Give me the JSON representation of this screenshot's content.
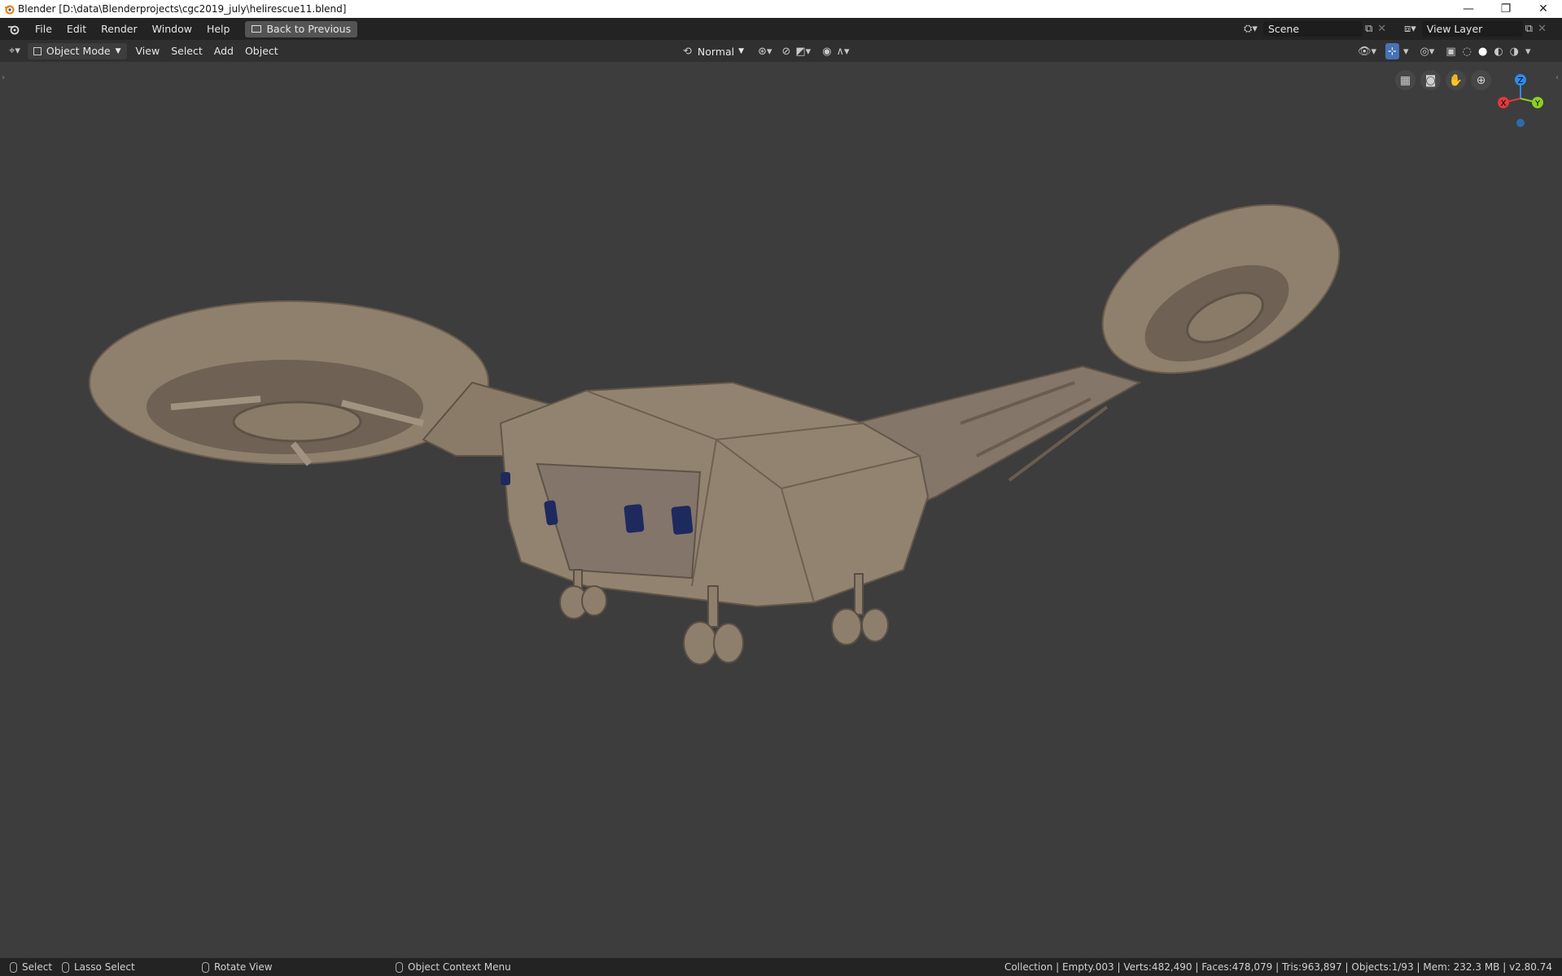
{
  "window": {
    "title": "Blender [D:\\data\\Blenderprojects\\cgc2019_july\\helirescue11.blend]",
    "minimize": "—",
    "restore": "❐",
    "close": "✕"
  },
  "menu": {
    "items": [
      "File",
      "Edit",
      "Render",
      "Window",
      "Help"
    ],
    "back_button": "Back to Previous"
  },
  "scene": {
    "value": "Scene"
  },
  "view_layer": {
    "value": "View Layer"
  },
  "header": {
    "mode": "Object Mode",
    "menus": [
      "View",
      "Select",
      "Add",
      "Object"
    ],
    "orientation": "Normal"
  },
  "gizmo": {
    "x": "X",
    "y": "Y",
    "z": "Z"
  },
  "colors": {
    "axis_x": "#e0393e",
    "axis_y": "#8ad123",
    "axis_z": "#2d8ceb",
    "model": "#8e7e6c",
    "viewport": "#3d3d3d"
  },
  "status": {
    "select": "Select",
    "lasso": "Lasso Select",
    "rotate": "Rotate View",
    "context": "Object Context Menu",
    "stats": "Collection | Empty.003 | Verts:482,490 | Faces:478,079 | Tris:963,897 | Objects:1/93 | Mem: 232.3 MB | v2.80.74"
  }
}
